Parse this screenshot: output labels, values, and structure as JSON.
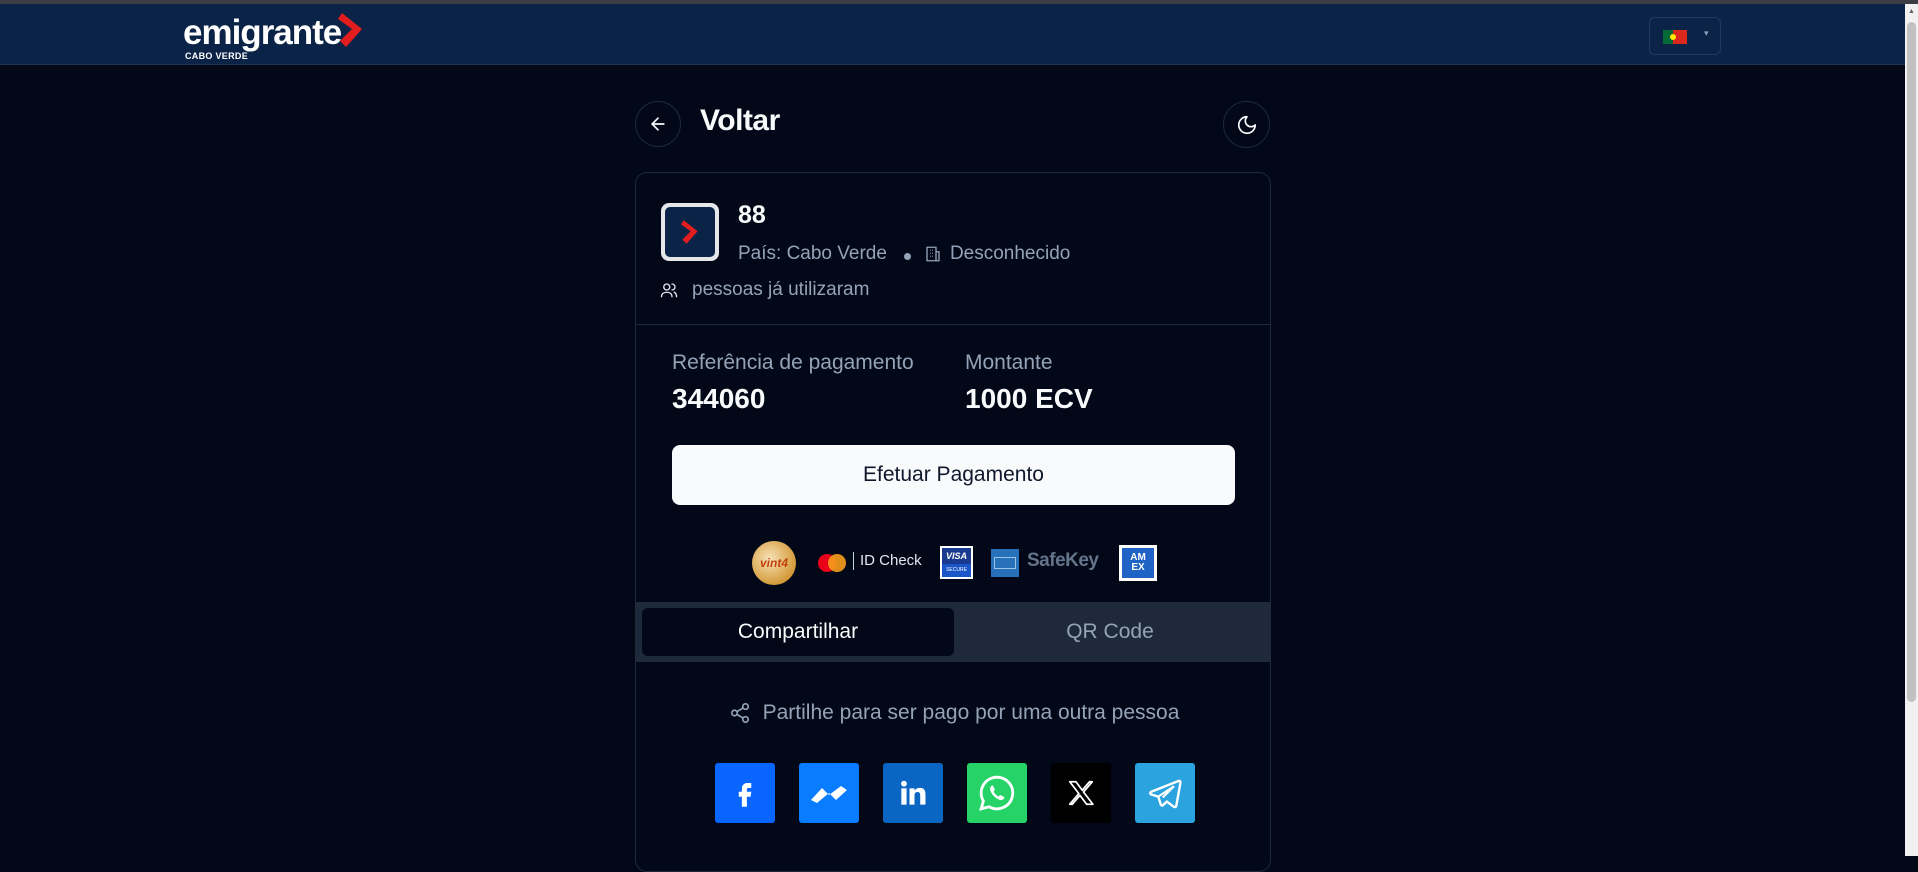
{
  "header": {
    "logo_text": "emigrante",
    "logo_sub": "CABO VERDE",
    "language_flag": "portugal-flag-icon"
  },
  "page": {
    "back_label": "Voltar"
  },
  "entity": {
    "name": "88",
    "country": "País: Cabo Verde",
    "type": "Desconhecido",
    "users_text": "pessoas já utilizaram"
  },
  "payment": {
    "reference_label": "Referência de pagamento",
    "reference_value": "344060",
    "amount_label": "Montante",
    "amount_value": "1000 ECV",
    "pay_button": "Efetuar Pagamento"
  },
  "badges": {
    "vint4": "vint4",
    "id_check": "ID Check",
    "visa_top": "VISA",
    "visa_bottom": "SECURE",
    "safekey": "SafeKey",
    "amex_top": "AM",
    "amex_bottom": "EX"
  },
  "tabs": [
    {
      "label": "Compartilhar",
      "active": true
    },
    {
      "label": "QR Code",
      "active": false
    }
  ],
  "share": {
    "text": "Partilhe para ser pago por uma outra pessoa",
    "networks": [
      "facebook-icon",
      "messenger-icon",
      "linkedin-icon",
      "whatsapp-icon",
      "x-icon",
      "telegram-icon"
    ]
  },
  "colors": {
    "background": "#020817",
    "header": "#0b2347",
    "accent_red": "#e11d1d"
  }
}
